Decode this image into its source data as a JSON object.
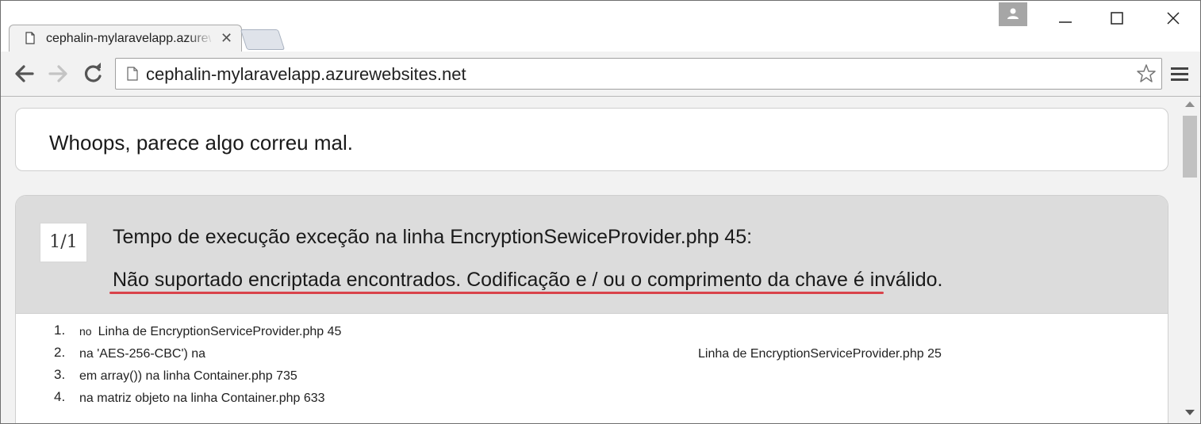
{
  "browser": {
    "tab_title": "cephalin-mylaravelapp.azurewebsites.net",
    "url": "cephalin-mylaravelapp.azurewebsites.net"
  },
  "page": {
    "whoops": "Whoops, parece algo correu mal.",
    "counter": "1/1",
    "exception_title": "Tempo de execução exceção na linha EncryptionSewiceProvider.php 45:",
    "exception_message": "Não suportado encriptada encontrados. Codificação e / ou o comprimento da chave é inválido.",
    "frames": [
      {
        "num": "1.",
        "prefix": "no",
        "text": "Linha de EncryptionServiceProvider.php 45",
        "right": ""
      },
      {
        "num": "2.",
        "prefix": "",
        "text": "na 'AES-256-CBC') na",
        "right": "Linha de EncryptionServiceProvider.php 25"
      },
      {
        "num": "3.",
        "prefix": "",
        "text": "em array()) na linha Container.php 735",
        "right": ""
      },
      {
        "num": "4.",
        "prefix": "",
        "text": "na matriz objeto na linha Container.php 633",
        "right": ""
      }
    ]
  },
  "colors": {
    "accent_underline": "#d9434b",
    "header_bg": "#dcdcdc"
  },
  "icons": [
    "page-icon",
    "close-icon",
    "user-icon",
    "minimize-icon",
    "maximize-icon",
    "window-close-icon",
    "back-icon",
    "forward-icon",
    "reload-icon",
    "star-icon",
    "menu-icon"
  ]
}
